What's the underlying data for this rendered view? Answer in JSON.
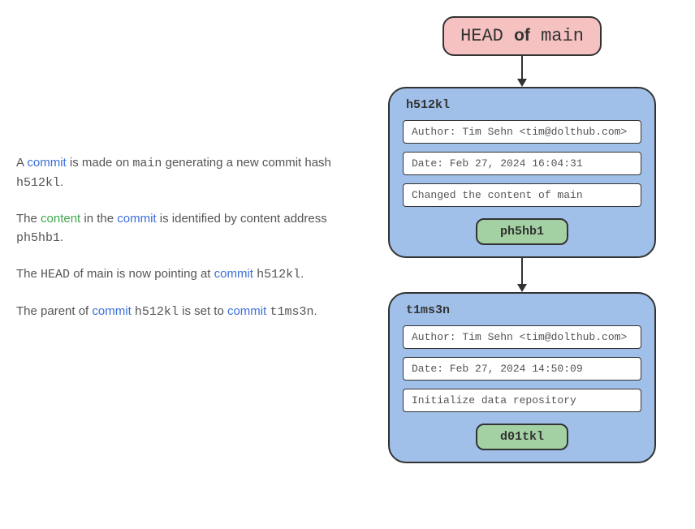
{
  "explanation": {
    "p1_a": "A ",
    "p1_commit": "commit",
    "p1_b": " is made on ",
    "p1_main": "main",
    "p1_c": " generating a new commit hash ",
    "p1_hash": "h512kl",
    "p1_d": ".",
    "p2_a": "The ",
    "p2_content": "content",
    "p2_b": " in the ",
    "p2_commit": "commit",
    "p2_c": " is identified by content address ",
    "p2_addr": "ph5hb1",
    "p2_d": ".",
    "p3_a": "The ",
    "p3_head": "HEAD",
    "p3_b": " of main is now pointing at ",
    "p3_commit": "commit",
    "p3_c": " ",
    "p3_hash": "h512kl",
    "p3_d": ".",
    "p4_a": "The parent of ",
    "p4_commit1": "commit",
    "p4_b": " ",
    "p4_hash1": "h512kl",
    "p4_c": " is set to ",
    "p4_commit2": "commit",
    "p4_d": " ",
    "p4_hash2": "t1ms3n",
    "p4_e": "."
  },
  "head": {
    "head_text": "HEAD",
    "of_text": "of",
    "branch_text": "main"
  },
  "commits": {
    "c1": {
      "hash": "h512kl",
      "author": "Author: Tim Sehn <tim@dolthub.com>",
      "date": "Date: Feb 27, 2024 16:04:31",
      "message": "Changed the content of main",
      "content_address": "ph5hb1"
    },
    "c2": {
      "hash": "t1ms3n",
      "author": "Author: Tim Sehn <tim@dolthub.com>",
      "date": "Date: Feb 27, 2024 14:50:09",
      "message": "Initialize data repository",
      "content_address": "d01tkl"
    }
  }
}
